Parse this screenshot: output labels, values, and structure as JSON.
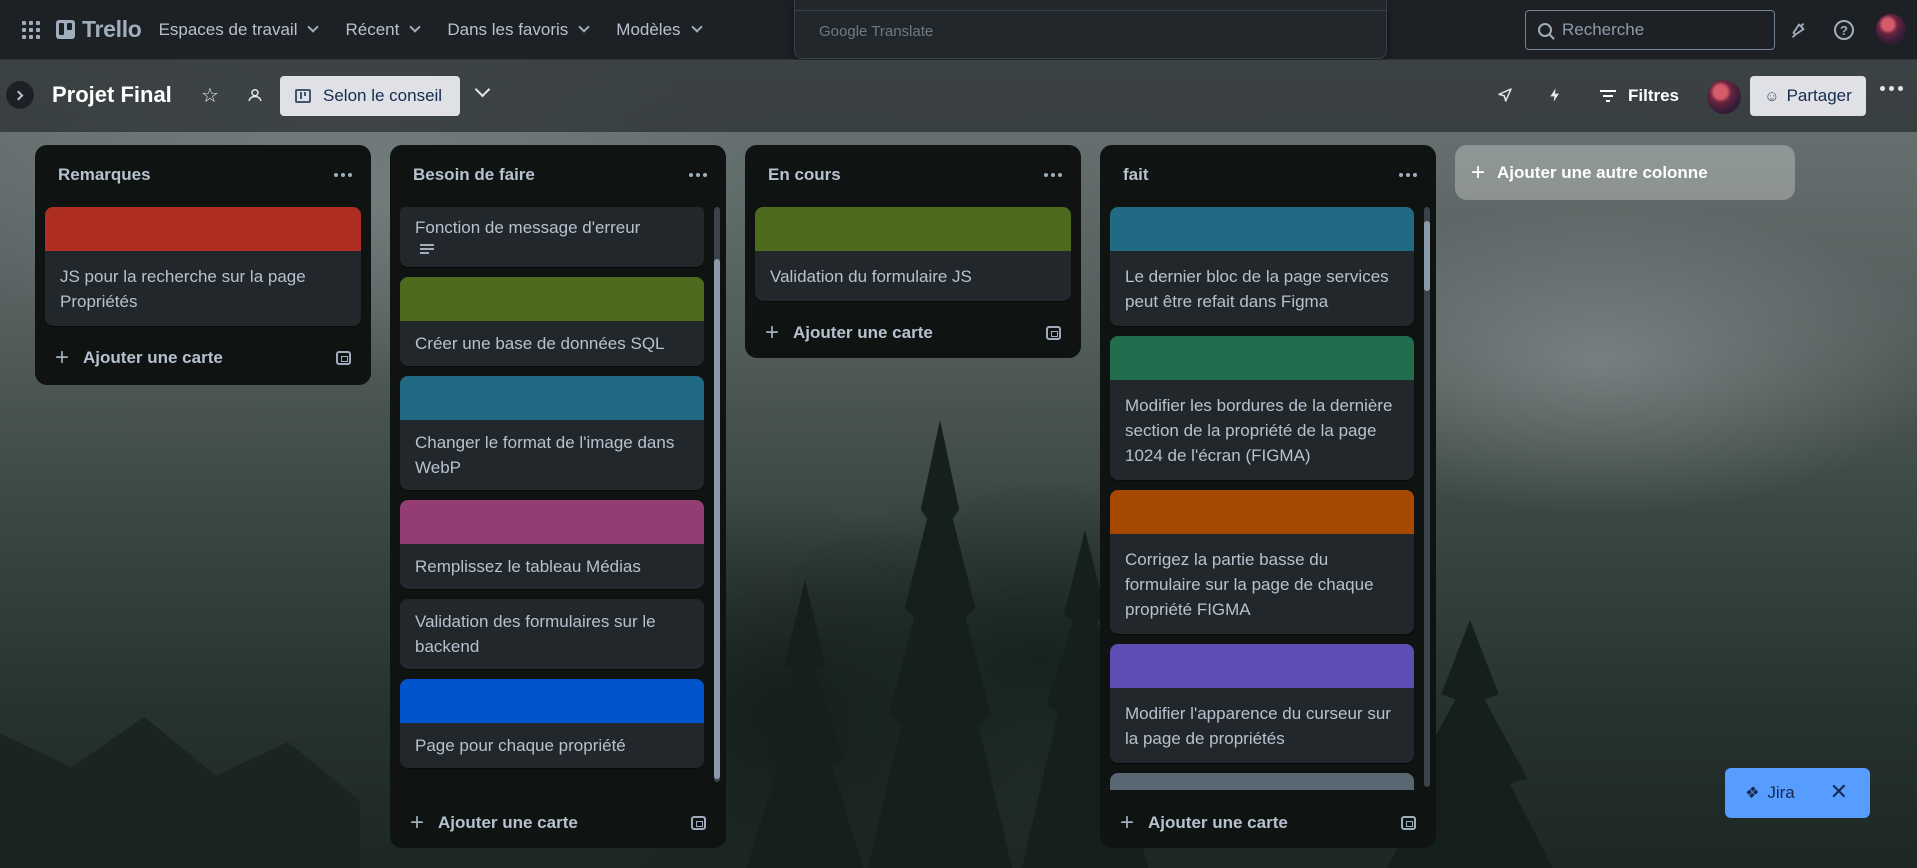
{
  "topbar": {
    "logo": "Trello",
    "nav": [
      "Espaces de travail",
      "Récent",
      "Dans les favoris",
      "Modèles"
    ],
    "google_translate": "Google Translate",
    "search_placeholder": "Recherche"
  },
  "board": {
    "title": "Projet Final",
    "view_label": "Selon le conseil",
    "filters_label": "Filtres",
    "share_label": "Partager"
  },
  "lists": [
    {
      "title": "Remarques",
      "cards": [
        {
          "cover": "#ae2e24",
          "text": "JS pour la recherche sur la page Propriétés"
        }
      ],
      "add_label": "Ajouter une carte"
    },
    {
      "title": "Besoin de faire",
      "cards": [
        {
          "cover": "",
          "text": "Fonction de message d'erreur"
        },
        {
          "cover": "#4c6b1f",
          "text": "Créer une base de données SQL"
        },
        {
          "cover": "#206a83",
          "text": "Changer le format de l'image dans WebP"
        },
        {
          "cover": "#943d73",
          "text": "Remplissez le tableau Médias"
        },
        {
          "cover": "",
          "text": "Validation des formulaires sur le backend"
        },
        {
          "cover": "#0055cc",
          "text": "Page pour chaque propriété"
        }
      ],
      "add_label": "Ajouter une carte"
    },
    {
      "title": "En cours",
      "cards": [
        {
          "cover": "#4c6b1f",
          "text": "Validation du formulaire JS"
        }
      ],
      "add_label": "Ajouter une carte"
    },
    {
      "title": "fait",
      "cards": [
        {
          "cover": "#206a83",
          "text": "Le dernier bloc de la page services peut être refait dans Figma"
        },
        {
          "cover": "#216e4e",
          "text": "Modifier les bordures de la dernière section de la propriété de la page 1024 de l'écran (FIGMA)"
        },
        {
          "cover": "#a54800",
          "text": "Corrigez la partie basse du formulaire sur la page de chaque propriété FIGMA"
        },
        {
          "cover": "#5e4db2",
          "text": "Modifier l'apparence du curseur sur la page de propriétés"
        },
        {
          "cover": "#596773",
          "text": ""
        }
      ],
      "add_label": "Ajouter une carte"
    }
  ],
  "add_list_label": "Ajouter une autre colonne",
  "jira": {
    "label": "Jira",
    "close": "✕"
  },
  "colors": {
    "red": "#ae2e24",
    "green": "#4c6b1f",
    "teal": "#206a83",
    "magenta": "#943d73",
    "blue": "#0055cc",
    "dark_green": "#216e4e",
    "orange": "#a54800",
    "purple": "#5e4db2",
    "gray": "#596773",
    "jira_blue": "#579dff"
  },
  "icons": [
    "apps-grid-icon",
    "trello-logo-icon",
    "search-icon",
    "notification-bell-icon",
    "help-icon",
    "star-icon",
    "workspace-visibility-icon",
    "board-view-icon",
    "rocket-icon",
    "automation-bolt-icon",
    "filter-icon",
    "add-member-icon",
    "more-icon",
    "description-icon",
    "template-icon",
    "close-icon"
  ]
}
